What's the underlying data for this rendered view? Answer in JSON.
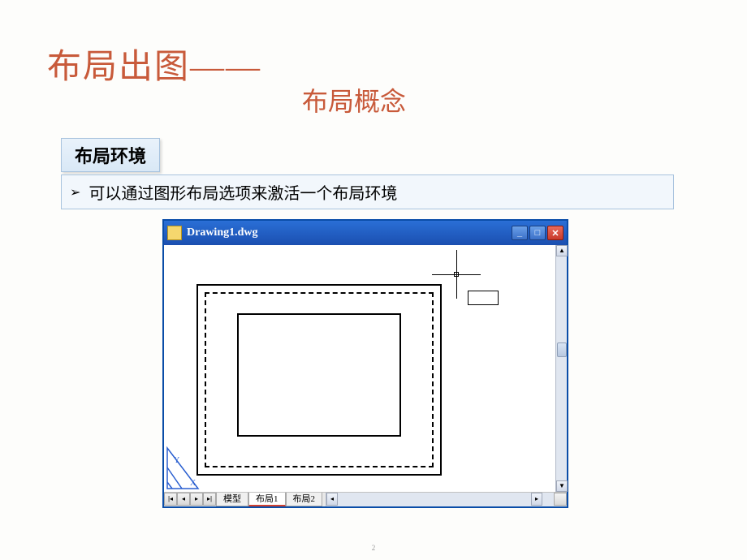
{
  "slide": {
    "title_main": "布局出图——",
    "title_sub": "布局概念",
    "section_label": "布局环境",
    "bullet_text": "可以通过图形布局选项来激活一个布局环境",
    "page_number": "2"
  },
  "cad_window": {
    "filename": "Drawing1.dwg",
    "tabs": {
      "model": "模型",
      "layout1": "布局1",
      "layout2": "布局2"
    }
  }
}
